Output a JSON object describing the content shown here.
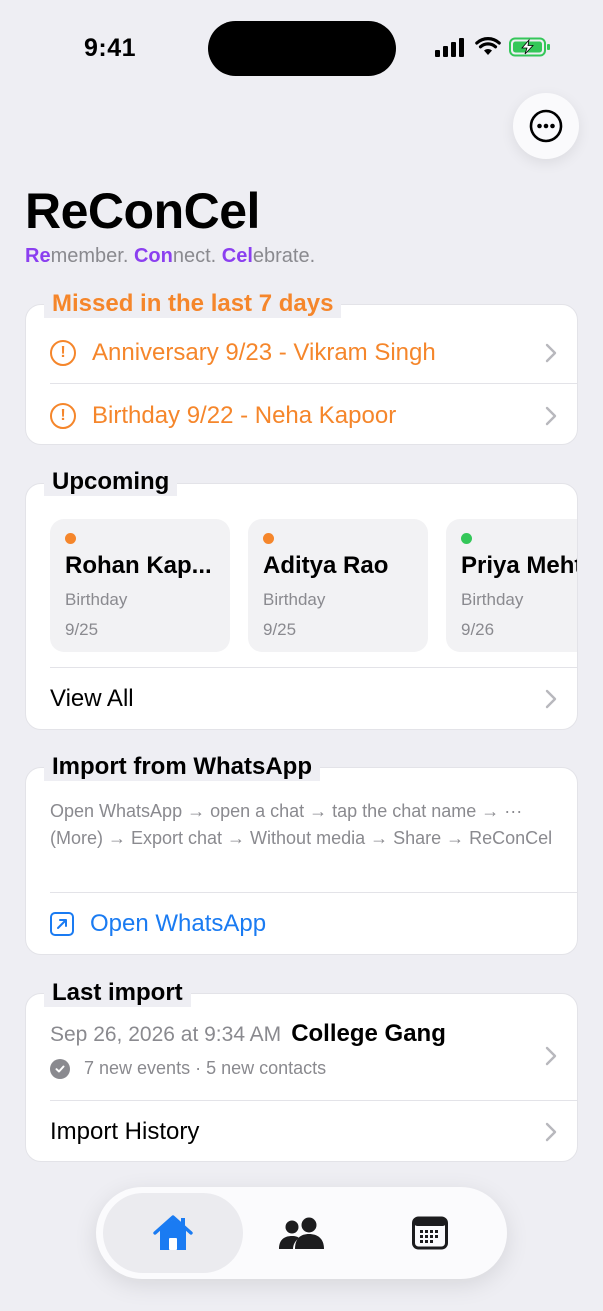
{
  "status_bar": {
    "time": "9:41"
  },
  "header": {
    "title": "ReConCel",
    "tagline": [
      {
        "accent": "Re",
        "rest": "member. "
      },
      {
        "accent": "Con",
        "rest": "nect. "
      },
      {
        "accent": "Cel",
        "rest": "ebrate."
      }
    ]
  },
  "missed": {
    "title": "Missed in the last 7 days",
    "items": [
      {
        "label": "Anniversary 9/23 - Vikram Singh"
      },
      {
        "label": "Birthday 9/22 - Neha Kapoor"
      }
    ]
  },
  "upcoming": {
    "title": "Upcoming",
    "tiles": [
      {
        "name": "Rohan Kap...",
        "kind": "Birthday",
        "date": "9/25",
        "dot_color": "#f5862b"
      },
      {
        "name": "Aditya Rao",
        "kind": "Birthday",
        "date": "9/25",
        "dot_color": "#f5862b"
      },
      {
        "name": "Priya Mehta",
        "kind": "Birthday",
        "date": "9/26",
        "dot_color": "#34c759"
      }
    ],
    "view_all": "View All"
  },
  "whatsapp": {
    "title": "Import from WhatsApp",
    "instructions": "Open WhatsApp → open a chat → tap the chat name → ··· (More) → Export chat → Without media → Share → ReConCel",
    "open_label": "Open WhatsApp"
  },
  "last_import": {
    "title": "Last import",
    "date": "Sep 26, 2026 at 9:34 AM",
    "group": "College Gang",
    "summary": "7 new events · 5 new contacts",
    "history_label": "Import History"
  },
  "tabbar": {
    "tabs": [
      {
        "icon": "home-icon",
        "active": true
      },
      {
        "icon": "people-icon",
        "active": false
      },
      {
        "icon": "calendar-icon",
        "active": false
      }
    ]
  },
  "colors": {
    "accent_purple": "#8b3ff0",
    "warning_orange": "#f5862b",
    "link_blue": "#1a7bf2",
    "success_green": "#34c759"
  }
}
